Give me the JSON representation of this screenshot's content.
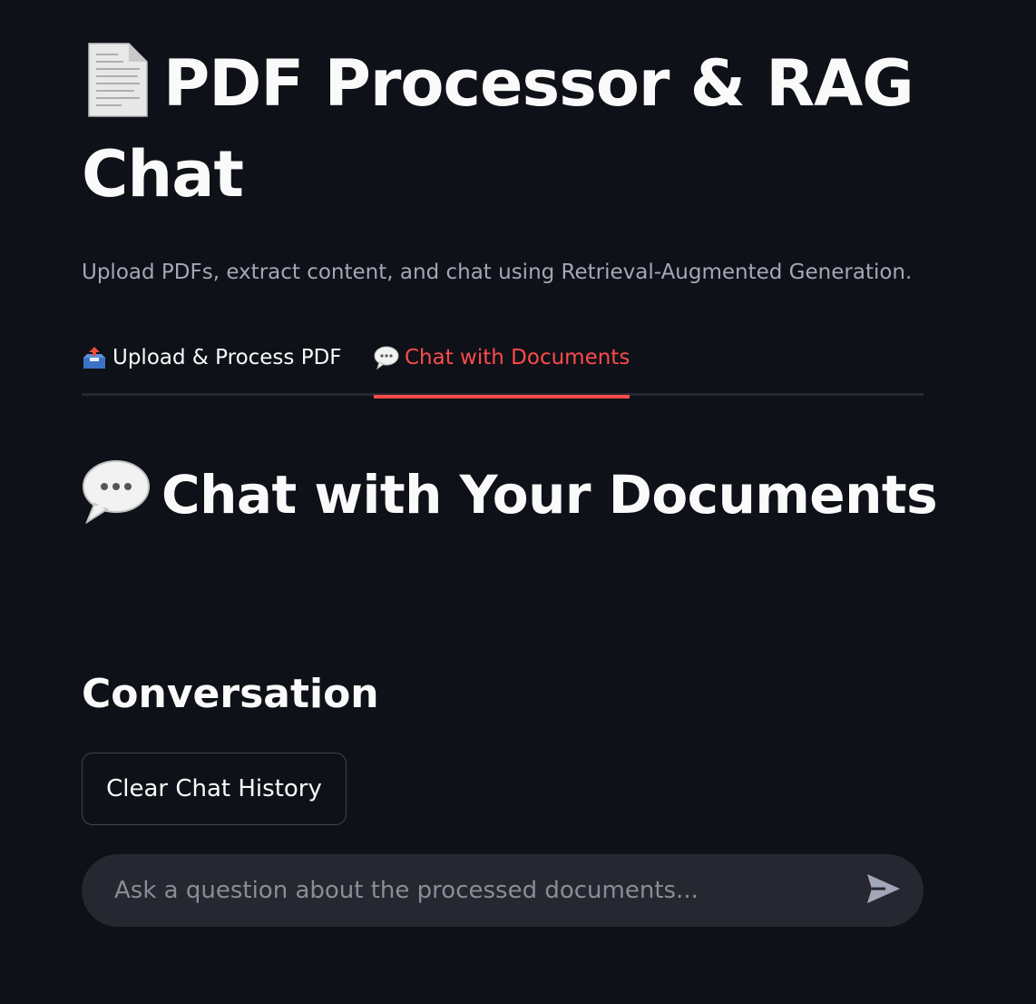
{
  "header": {
    "title": "PDF Processor & RAG Chat",
    "title_icon": "page-facing-up-icon",
    "subtitle": "Upload PDFs, extract content, and chat using Retrieval-Augmented Generation."
  },
  "tabs": [
    {
      "label": "Upload & Process PDF",
      "icon": "outbox-tray-icon",
      "active": false
    },
    {
      "label": "Chat with Documents",
      "icon": "speech-balloon-icon",
      "active": true
    }
  ],
  "chat": {
    "section_title": "Chat with Your Documents",
    "section_icon": "speech-balloon-icon",
    "conversation_title": "Conversation",
    "clear_button_label": "Clear Chat History",
    "input_placeholder": "Ask a question about the processed documents...",
    "input_value": ""
  },
  "colors": {
    "background": "#0e1117",
    "accent": "#ff4b4b",
    "text": "#fafafa",
    "muted": "#a3a8b8",
    "input_bg": "#262730"
  }
}
